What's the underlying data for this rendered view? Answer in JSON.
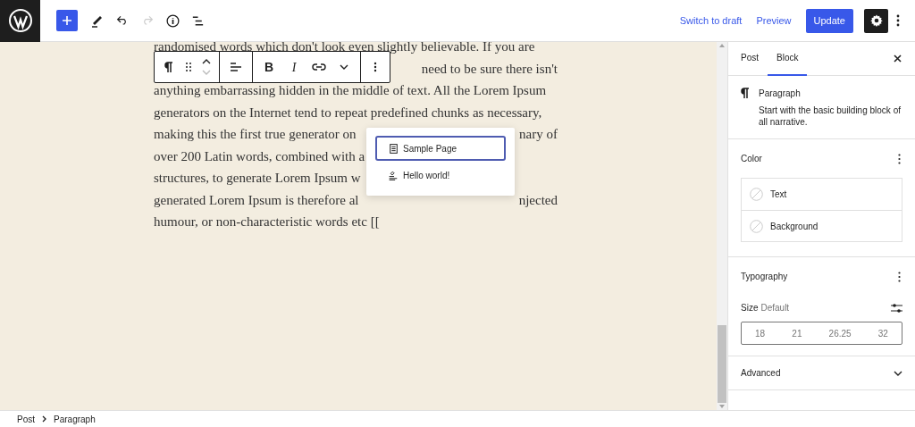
{
  "header": {
    "actions": [
      {
        "kind": "link",
        "label": "Switch to draft"
      },
      {
        "kind": "link",
        "label": "Preview"
      },
      {
        "kind": "primary",
        "label": "Update"
      }
    ],
    "settings_active": true,
    "redo_disabled": true
  },
  "block_toolbar": {
    "bold_label": "B",
    "italic_label": "I"
  },
  "content": {
    "lines": [
      {
        "left": "randomised words which don't look even slightly believable. If you are"
      },
      {
        "right": "need to be sure there isn't"
      },
      {
        "left": "anything embarrassing hidden in the middle of text. All the Lorem Ipsum"
      },
      {
        "left": "generators on the Internet tend to repeat predefined chunks as necessary,"
      },
      {
        "left": "making this the first true generator on",
        "right": "nary of"
      },
      {
        "left": "over 200 Latin words, combined with a"
      },
      {
        "left": "structures, to generate Lorem Ipsum w"
      },
      {
        "left": "generated Lorem Ipsum is therefore al",
        "right": "njected"
      },
      {
        "left": "humour, or non-characteristic words etc [["
      }
    ]
  },
  "link_suggestions": [
    {
      "kind": "page",
      "label": "Sample Page",
      "selected": true
    },
    {
      "kind": "post",
      "label": "Hello world!",
      "selected": false
    }
  ],
  "sidebar": {
    "tabs": [
      {
        "label": "Post",
        "selected": false
      },
      {
        "label": "Block",
        "selected": true
      }
    ],
    "block_card": {
      "title": "Paragraph",
      "description": "Start with the basic building block of all narrative."
    },
    "color": {
      "title": "Color",
      "items": [
        "Text",
        "Background"
      ]
    },
    "typography": {
      "title": "Typography",
      "size_label": "Size",
      "size_value": "Default",
      "sizes": [
        "18",
        "21",
        "26.25",
        "32"
      ]
    },
    "advanced": {
      "title": "Advanced",
      "expanded": false
    }
  },
  "breadcrumbs": [
    "Post",
    "Paragraph"
  ]
}
